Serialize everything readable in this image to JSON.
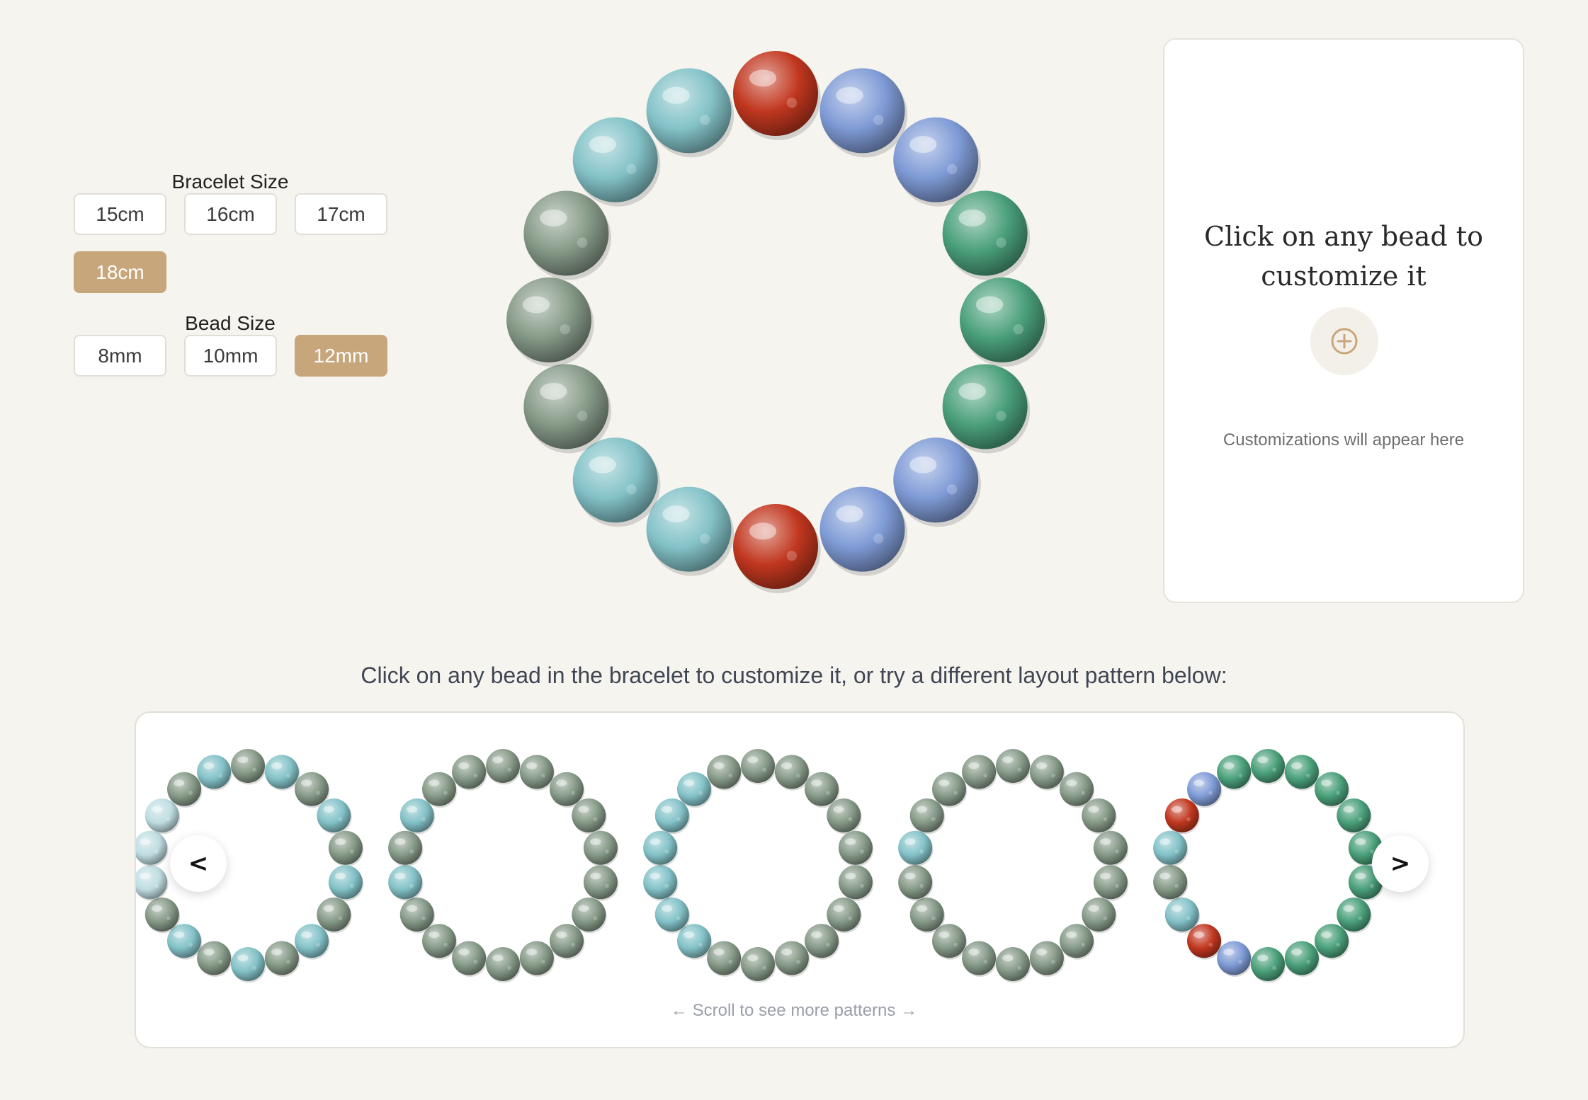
{
  "bracelet_size": {
    "label": "Bracelet Size",
    "options": [
      "15cm",
      "16cm",
      "17cm",
      "18cm"
    ],
    "selected": "18cm"
  },
  "bead_size": {
    "label": "Bead Size",
    "options": [
      "8mm",
      "10mm",
      "12mm"
    ],
    "selected": "12mm"
  },
  "stone_colors": {
    "red": "#c1371f",
    "blue": "#7f9bd6",
    "green": "#4aa07a",
    "sage": "#869a88",
    "aqua": "#83c2c8",
    "paleaqua": "#bfdde1"
  },
  "main_bracelet": {
    "beads": [
      "red",
      "blue",
      "blue",
      "green",
      "green",
      "green",
      "blue",
      "blue",
      "red",
      "aqua",
      "aqua",
      "sage",
      "sage",
      "sage",
      "aqua",
      "aqua"
    ]
  },
  "panel": {
    "title": "Click on any bead to customize it",
    "icon": "plus-circle-icon",
    "hint": "Customizations will appear here"
  },
  "instruction": "Click on any bead in the bracelet to customize it, or try a different layout pattern below:",
  "carousel": {
    "prev_label": "<",
    "next_label": ">",
    "scroll_hint": "← Scroll to see more patterns →",
    "patterns": [
      {
        "beads": [
          "sage",
          "aqua",
          "sage",
          "aqua",
          "sage",
          "aqua",
          "sage",
          "aqua",
          "sage",
          "aqua",
          "sage",
          "aqua",
          "sage",
          "paleaqua",
          "paleaqua",
          "paleaqua",
          "sage",
          "aqua"
        ]
      },
      {
        "beads": [
          "sage",
          "sage",
          "sage",
          "sage",
          "sage",
          "sage",
          "sage",
          "sage",
          "sage",
          "sage",
          "sage",
          "sage",
          "sage",
          "aqua",
          "sage",
          "aqua",
          "sage",
          "sage"
        ]
      },
      {
        "beads": [
          "sage",
          "sage",
          "sage",
          "sage",
          "sage",
          "sage",
          "sage",
          "sage",
          "sage",
          "sage",
          "sage",
          "aqua",
          "aqua",
          "aqua",
          "aqua",
          "aqua",
          "aqua",
          "sage"
        ]
      },
      {
        "beads": [
          "sage",
          "sage",
          "sage",
          "sage",
          "sage",
          "sage",
          "sage",
          "sage",
          "sage",
          "sage",
          "sage",
          "sage",
          "sage",
          "sage",
          "aqua",
          "sage",
          "sage",
          "sage"
        ]
      },
      {
        "beads": [
          "green",
          "green",
          "green",
          "green",
          "green",
          "green",
          "green",
          "green",
          "green",
          "green",
          "blue",
          "red",
          "aqua",
          "sage",
          "aqua",
          "red",
          "blue",
          "green"
        ]
      }
    ]
  }
}
